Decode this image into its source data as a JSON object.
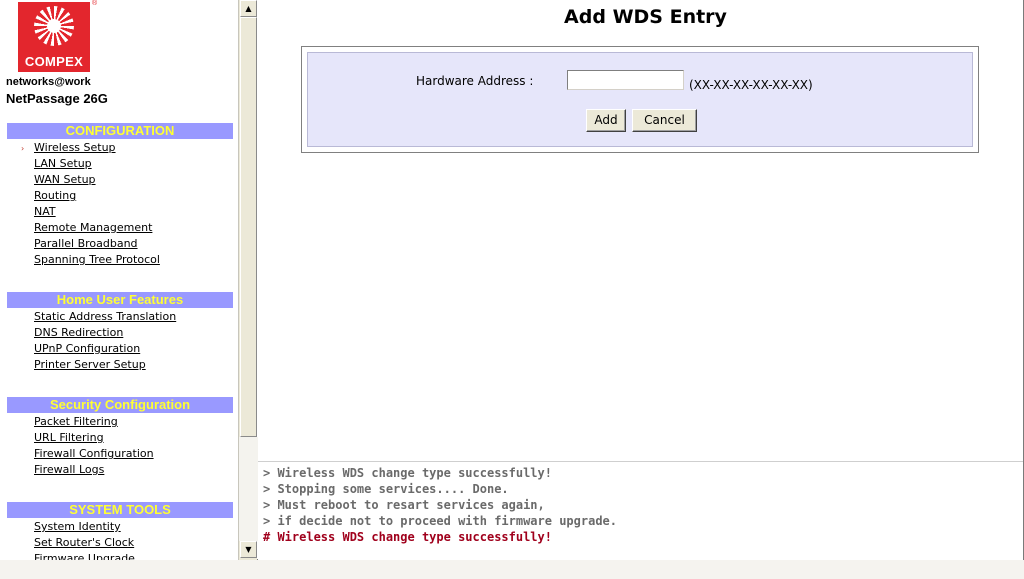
{
  "logo": {
    "brand": "COMPEX",
    "registered": "®"
  },
  "tagline": "networks@work",
  "product": "NetPassage 26G",
  "nav": {
    "sections": [
      {
        "title": "CONFIGURATION",
        "items": [
          "Wireless Setup",
          "LAN Setup",
          "WAN Setup",
          "Routing",
          "NAT",
          "Remote Management",
          "Parallel Broadband",
          "Spanning Tree Protocol"
        ]
      },
      {
        "title": "Home User Features",
        "items": [
          "Static Address Translation",
          "DNS Redirection",
          "UPnP Configuration",
          "Printer Server Setup"
        ]
      },
      {
        "title": "Security Configuration",
        "items": [
          "Packet Filtering",
          "URL Filtering",
          "Firewall Configuration",
          "Firewall Logs"
        ]
      },
      {
        "title": "SYSTEM TOOLS",
        "items": [
          "System Identity",
          "Set Router's Clock",
          "Firmware Upgrade"
        ]
      }
    ],
    "active_marker": "›"
  },
  "main": {
    "title": "Add WDS Entry",
    "hw_label": "Hardware Address :",
    "hw_value": "",
    "hw_format": "(XX-XX-XX-XX-XX-XX)",
    "add_label": "Add",
    "cancel_label": "Cancel"
  },
  "log": {
    "lines": [
      "> Wireless WDS change type successfully!",
      "> Stopping some services.... Done.",
      "> Must reboot to resart services again,",
      "> if decide not to proceed with firmware upgrade.",
      "# Wireless WDS change type successfully!"
    ]
  },
  "scrollbar": {
    "up": "▲",
    "down": "▼"
  },
  "colors": {
    "section_bg": "#9999ff",
    "section_text": "#ffff33",
    "form_bg": "#e6e6fa",
    "alert": "#a0001c",
    "logo_red": "#e3262d"
  }
}
